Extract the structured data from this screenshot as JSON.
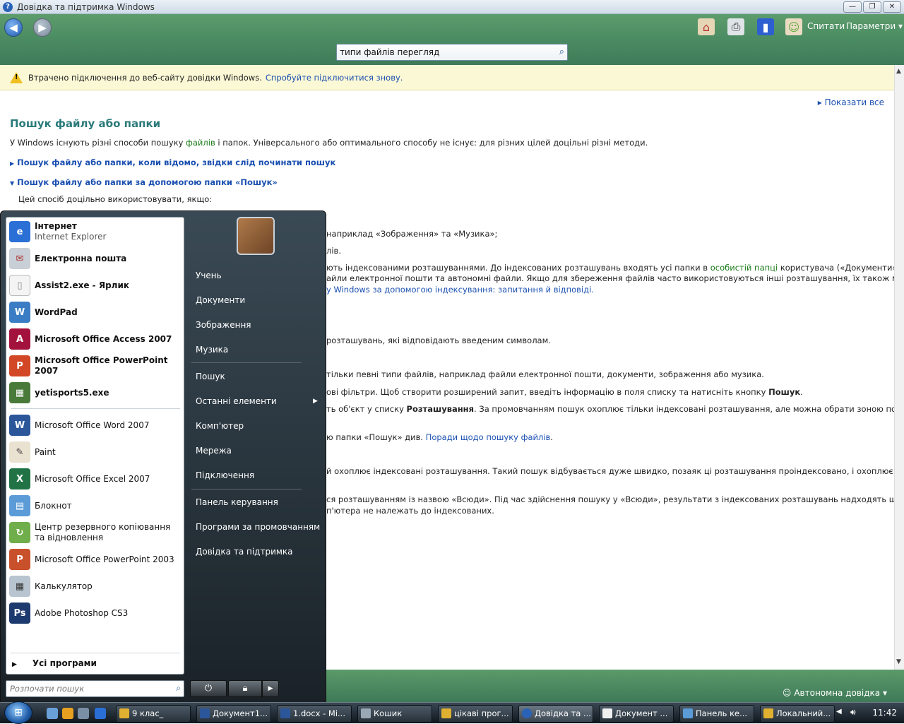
{
  "window": {
    "title": "Довідка та підтримка Windows",
    "min": "—",
    "max": "❐",
    "close": "✕"
  },
  "toolbar": {
    "back": "◀",
    "forward": "▶",
    "ask": "Спитати",
    "options": "Параметри ▾"
  },
  "search": {
    "value": "типи файлів перегляд"
  },
  "infobar": {
    "message": "Втрачено підключення до веб-сайту довідки Windows.",
    "link": "Спробуйте підключитися знову."
  },
  "article": {
    "show_all": "Показати все",
    "title": "Пошук файлу або папки",
    "intro_a": "У Windows існують різні способи пошуку ",
    "intro_link": "файлів",
    "intro_b": " і папок. Універсального або оптимального способу не існує: для різних цілей доцільні різні методи.",
    "section1": "Пошук файлу або папки, коли відомо, звідки слід починати пошук",
    "section2": "Пошук файлу або папки за допомогою папки «Пошук»",
    "use_when": "Цей спосіб доцільно використовувати, якщо:",
    "l1": "наприклад «Зображення» та «Музика»;",
    "l2": "лів.",
    "l3a": "ють індексованими розташуваннями. До індексованих розташувань входять усі папки в ",
    "l3link": "особистій папці",
    "l3b": " користувача («Документи»,",
    "l4": "айли електронної пошти та автономні файли. Якщо для збереження файлів часто використовуються інші розташування, їх також можна",
    "l5": "у Windows за допомогою індексування: запитання й відповіді.",
    "l6": "розташувань, які відповідають введеним символам.",
    "l7": "тільки певні типи файлів, наприклад файли електронної пошти, документи, зображення або музика.",
    "l8a": "ові фільтри. Щоб створити розширений запит, введіть інформацію в поля списку та натисніть кнопку ",
    "l8b": "Пошук",
    "l8c": ".",
    "l9a": "ть об'єкт у списку ",
    "l9b": "Розташування",
    "l9c": ". За промовчанням пошук охоплює тільки індексовані розташування, але можна обрати зоною пошуку",
    "l10a": "ю папки «Пошук» див. ",
    "l10link": "Поради щодо пошуку файлів",
    "l10b": ".",
    "l11": "й охоплює індексовані розташування. Такий пошук відбувається дуже швидко, позаяк ці розташування проіндексовано, і охоплює всі",
    "l12": "ся розташуванням із назвою «Всюди». Під час здійснення пошуку у «Всюди», результати з індексованих розташувань надходять швидко, а",
    "l13": "п'ютера не належать до індексованих."
  },
  "start_menu": {
    "pinned": [
      {
        "title": "Інтернет",
        "sub": "Internet Explorer"
      },
      {
        "title": "Електронна пошта"
      },
      {
        "title": "Assist2.exe - Ярлик"
      },
      {
        "title": "WordPad"
      },
      {
        "title": "Microsoft Office Access 2007"
      },
      {
        "title": "Microsoft Office PowerPoint 2007"
      },
      {
        "title": "yetisports5.exe"
      }
    ],
    "recent": [
      "Microsoft Office Word 2007",
      "Paint",
      "Microsoft Office Excel 2007",
      "Блокнот",
      "Центр резервного копіювання та відновлення",
      "Microsoft Office PowerPoint 2003",
      "Калькулятор",
      "Adobe Photoshop CS3"
    ],
    "all_programs": "Усі програми",
    "search_placeholder": "Розпочати пошук",
    "right": [
      "Учень",
      "Документи",
      "Зображення",
      "Музика",
      "Пошук",
      "Останні елементи",
      "Комп'ютер",
      "Мережа",
      "Підключення",
      "Панель керування",
      "Програми за промовчанням",
      "Довідка та підтримка"
    ]
  },
  "status": {
    "offline": "Автономна довідка ▾"
  },
  "taskbar": {
    "buttons": [
      "9 клас_",
      "Документ1...",
      "1.docx - Mi...",
      "Кошик",
      "цікаві прог...",
      "Довідка та ...",
      "Документ ...",
      "Панель ке...",
      "Локальний..."
    ],
    "clock": "11:42"
  },
  "colors": {
    "toolbar": "#4c8d63",
    "title_teal": "#2a7a7a",
    "link": "#1a4fb0",
    "start_menu": "#1a2228"
  }
}
